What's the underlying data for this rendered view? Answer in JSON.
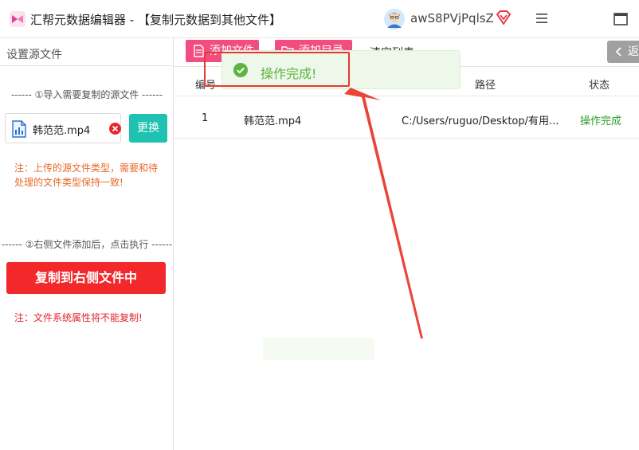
{
  "window": {
    "title": "汇帮元数据编辑器 - 【复制元数据到其他文件】",
    "username": "awS8PVjPqlsZ"
  },
  "left_panel": {
    "title": "设置源文件",
    "step1_hint": "------ ①导入需要复制的源文件 ------",
    "source_file": "韩范范.mp4",
    "replace_label": "更换",
    "note_type": "注：上传的源文件类型，需要和待处理的文件类型保持一致!",
    "step2_hint": "------ ②右侧文件添加后，点击执行 ------",
    "copy_label": "复制到右侧文件中",
    "note_fs": "注：文件系统属性将不能复制!"
  },
  "toolbar": {
    "add_file_label": "添加文件",
    "add_folder_label": "添加目录",
    "clear_list_label": "清空列表",
    "back_label": "返回"
  },
  "table": {
    "headers": {
      "index": "编号",
      "path": "路径",
      "status": "状态"
    },
    "rows": [
      {
        "index": "1",
        "name": "韩范范.mp4",
        "path": "C:/Users/ruguo/Desktop/有用...",
        "status": "操作完成"
      }
    ]
  },
  "toast": {
    "message": "操作完成!"
  },
  "colors": {
    "accent_red": "#f3282a",
    "teal": "#1fc1b0",
    "pink": "#f14d80",
    "success_green": "#2ea02e",
    "annotation_red": "#e33a30"
  }
}
